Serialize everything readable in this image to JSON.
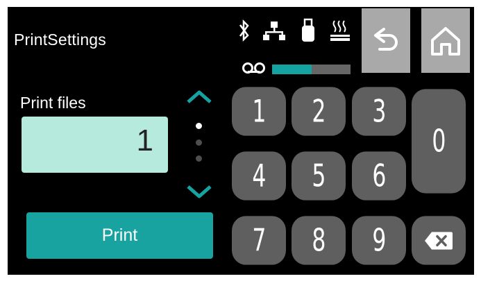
{
  "header": {
    "title": "PrintSettings",
    "icons": [
      "bluetooth-icon",
      "network-icon",
      "usb-icon",
      "heating-icon",
      "tape-icon"
    ],
    "progress": 0.5,
    "accent": "#14a3a1"
  },
  "form": {
    "label": "Print files",
    "value": "1"
  },
  "print_button": "Print",
  "keypad": {
    "keys": [
      "1",
      "2",
      "3",
      "0",
      "4",
      "5",
      "6",
      "7",
      "8",
      "9"
    ]
  },
  "colors": {
    "field_bg": "#b5eadd",
    "button_bg": "#19a3a0",
    "key_bg": "#5f5f5f",
    "tile_bg": "#a9a9a9"
  }
}
